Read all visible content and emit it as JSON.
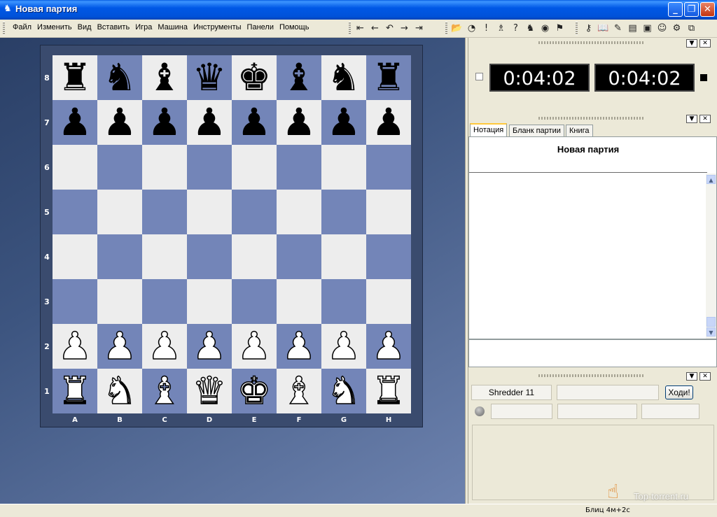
{
  "window": {
    "title": "Новая партия",
    "min": "_",
    "max": "❐",
    "close": "✕"
  },
  "menu": [
    "Файл",
    "Изменить",
    "Вид",
    "Вставить",
    "Игра",
    "Машина",
    "Инструменты",
    "Панели",
    "Помощь"
  ],
  "toolbar": {
    "navigation": [
      "⇤",
      "←",
      "↶",
      "→",
      "⇥"
    ],
    "tools1": [
      "📂",
      "◔",
      "!",
      "♗",
      "?",
      "♞",
      "◉",
      "⚑"
    ],
    "tools2": [
      "⚷",
      "📖",
      "✎",
      "▤",
      "▣",
      "☺",
      "⚙",
      "⧉"
    ]
  },
  "board": {
    "files": [
      "A",
      "B",
      "C",
      "D",
      "E",
      "F",
      "G",
      "H"
    ],
    "ranks": [
      "8",
      "7",
      "6",
      "5",
      "4",
      "3",
      "2",
      "1"
    ],
    "rows": [
      [
        "♜",
        "♞",
        "♝",
        "♛",
        "♚",
        "♝",
        "♞",
        "♜"
      ],
      [
        "♟",
        "♟",
        "♟",
        "♟",
        "♟",
        "♟",
        "♟",
        "♟"
      ],
      [
        "",
        "",
        "",
        "",
        "",
        "",
        "",
        ""
      ],
      [
        "",
        "",
        "",
        "",
        "",
        "",
        "",
        ""
      ],
      [
        "",
        "",
        "",
        "",
        "",
        "",
        "",
        ""
      ],
      [
        "",
        "",
        "",
        "",
        "",
        "",
        "",
        ""
      ],
      [
        "♟",
        "♟",
        "♟",
        "♟",
        "♟",
        "♟",
        "♟",
        "♟"
      ],
      [
        "♜",
        "♞",
        "♝",
        "♛",
        "♚",
        "♝",
        "♞",
        "♜"
      ]
    ],
    "colors": [
      "b",
      "b",
      "",
      "",
      "",
      "",
      "w",
      "w"
    ],
    "light_color": "#EDEDED",
    "dark_color": "#7385B8"
  },
  "clocks": {
    "white": "0:04:02",
    "black": "0:04:02"
  },
  "notation": {
    "tabs": [
      "Нотация",
      "Бланк партии",
      "Книга"
    ],
    "active_tab": 0,
    "title": "Новая партия"
  },
  "engine": {
    "name": "Shredder 11",
    "move_button": "Ходи!"
  },
  "status": {
    "mode": "Блиц 4м+2с"
  },
  "watermark": "Top-torrent.ru",
  "panel_buttons": {
    "dropdown": "▼",
    "close": "✕"
  }
}
